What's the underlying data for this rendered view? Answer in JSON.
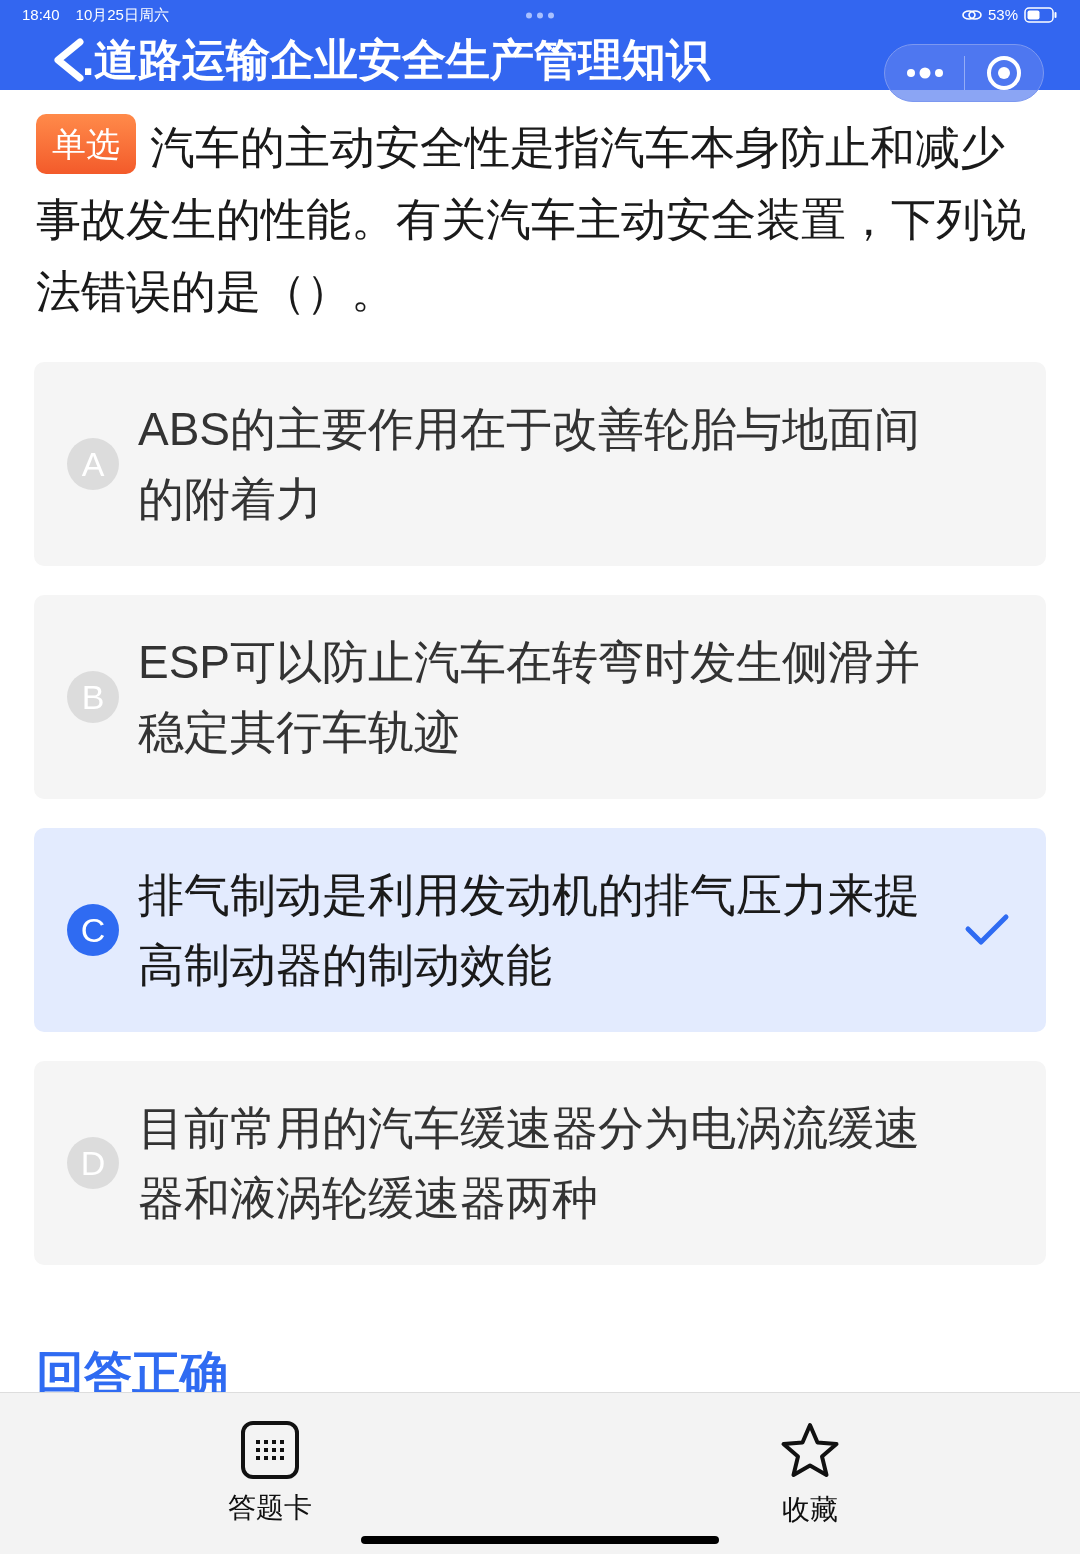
{
  "status_bar": {
    "time": "18:40",
    "date": "10月25日周六",
    "battery": "53%"
  },
  "header": {
    "title": ".道路运输企业安全生产管理知识"
  },
  "question": {
    "type_badge": "单选",
    "text": "汽车的主动安全性是指汽车本身防止和减少事故发生的性能。有关汽车主动安全装置，下列说法错误的是（）。"
  },
  "options": [
    {
      "letter": "A",
      "text": "ABS的主要作用在于改善轮胎与地面间的附着力",
      "selected": false
    },
    {
      "letter": "B",
      "text": "ESP可以防止汽车在转弯时发生侧滑并稳定其行车轨迹",
      "selected": false
    },
    {
      "letter": "C",
      "text": "排气制动是利用发动机的排气压力来提高制动器的制动效能",
      "selected": true
    },
    {
      "letter": "D",
      "text": "目前常用的汽车缓速器分为电涡流缓速器和液涡轮缓速器两种",
      "selected": false
    }
  ],
  "result": "回答正确",
  "bottom_bar": [
    {
      "kind": "grid",
      "label": "答题卡"
    },
    {
      "kind": "star",
      "label": "收藏"
    }
  ]
}
